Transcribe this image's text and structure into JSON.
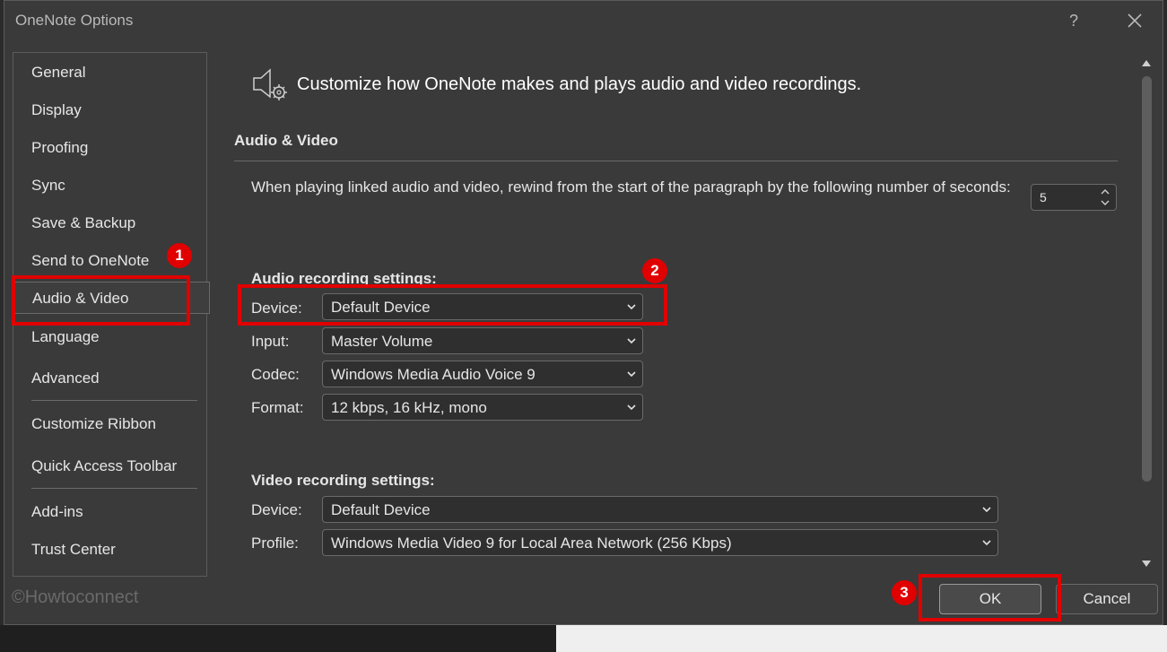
{
  "window": {
    "title": "OneNote Options",
    "help_label": "?"
  },
  "nav": {
    "items": [
      "General",
      "Display",
      "Proofing",
      "Sync",
      "Save & Backup",
      "Send to OneNote",
      "Audio & Video",
      "Language",
      "Advanced",
      "Customize Ribbon",
      "Quick Access Toolbar",
      "Add-ins",
      "Trust Center"
    ],
    "selected": "Audio & Video"
  },
  "header": {
    "text": "Customize how OneNote makes and plays audio and video recordings."
  },
  "audio_video": {
    "section_title": "Audio & Video",
    "rewind_text": "When playing linked audio and video, rewind from the start of the paragraph by the following number of seconds:",
    "rewind_value": "5"
  },
  "audio_recording": {
    "title": "Audio recording settings:",
    "device_label": "Device:",
    "device_value": "Default Device",
    "input_label": "Input:",
    "input_value": "Master Volume",
    "codec_label": "Codec:",
    "codec_value": "Windows Media Audio Voice 9",
    "format_label": "Format:",
    "format_value": "12 kbps, 16 kHz, mono"
  },
  "video_recording": {
    "title": "Video recording settings:",
    "device_label": "Device:",
    "device_value": "Default Device",
    "profile_label": "Profile:",
    "profile_value": "Windows Media Video 9 for Local Area Network (256 Kbps)"
  },
  "buttons": {
    "ok": "OK",
    "cancel": "Cancel"
  },
  "watermark": "©Howtoconnect",
  "annotations": [
    "1",
    "2",
    "3"
  ],
  "colors": {
    "annotation_red": "#e00000",
    "dialog_bg": "#3a3a3a"
  }
}
